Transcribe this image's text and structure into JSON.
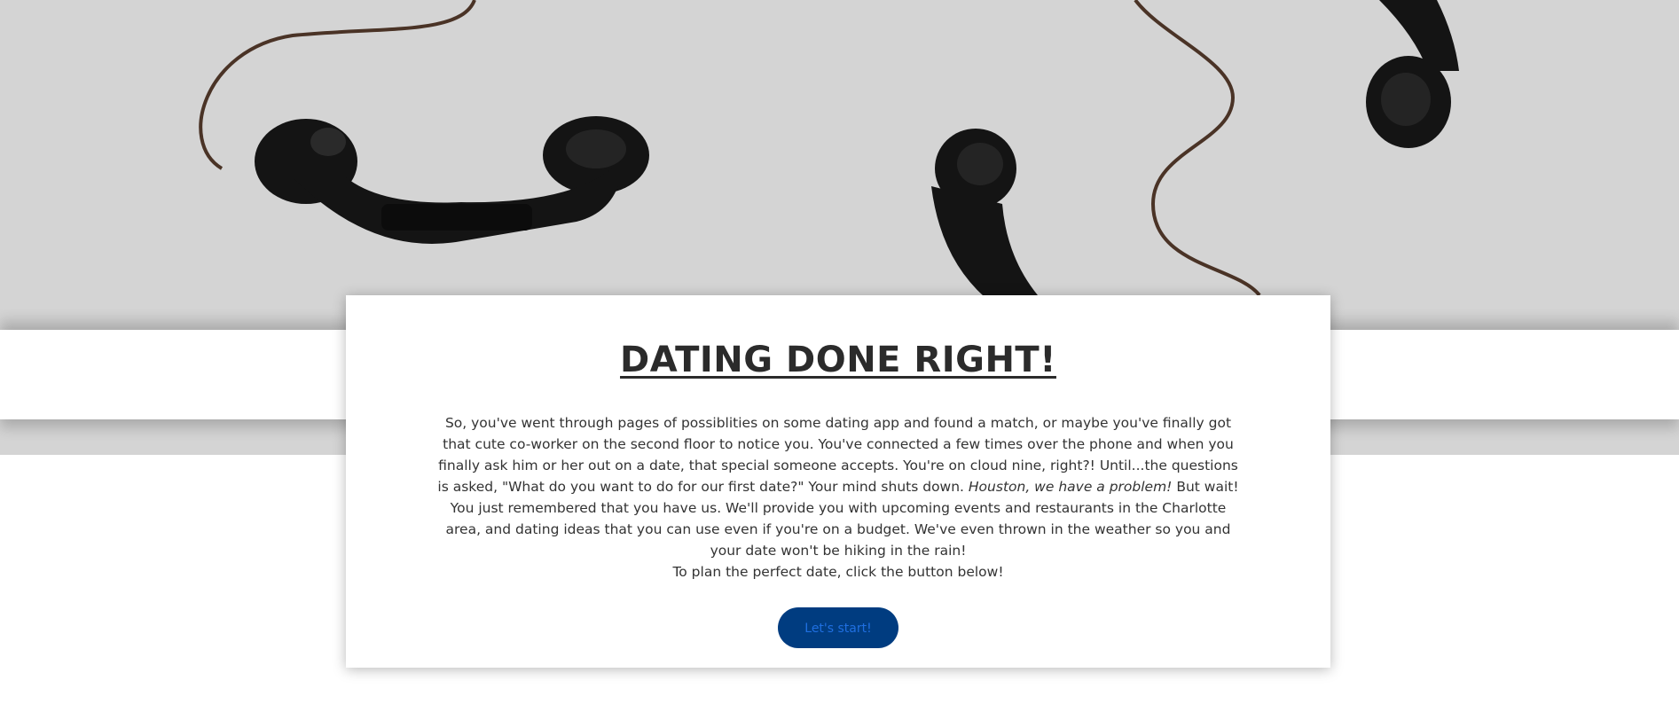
{
  "hero": {
    "decoration": "telephone-handsets"
  },
  "card": {
    "title": "DATING DONE RIGHT!",
    "intro_part1": "So, you've went through pages of possiblities on some dating app and found a match, or maybe you've finally got that cute co-worker on the second floor to notice you. You've connected a few times over the phone and when you finally ask him or her out on a date, that special someone accepts. You're on cloud nine, right?! Until...the questions is asked, \"What do you want to do for our first date?\" Your mind shuts down. ",
    "intro_emphasis": "Houston, we have a problem!",
    "intro_part2": " But wait! You just remembered that you have us. We'll provide you with upcoming events and restaurants in the Charlotte area, and dating ideas that you can use even if you're on a budget. We've even thrown in the weather so you and your date won't be hiking in the rain!",
    "instruction": "To plan the perfect date, click the button below!",
    "button_label": "Let's start!"
  },
  "colors": {
    "hero_background": "#d4d4d4",
    "button_background": "#003c80",
    "button_text": "#1f6fe0",
    "title_text": "#2b2b2b"
  }
}
